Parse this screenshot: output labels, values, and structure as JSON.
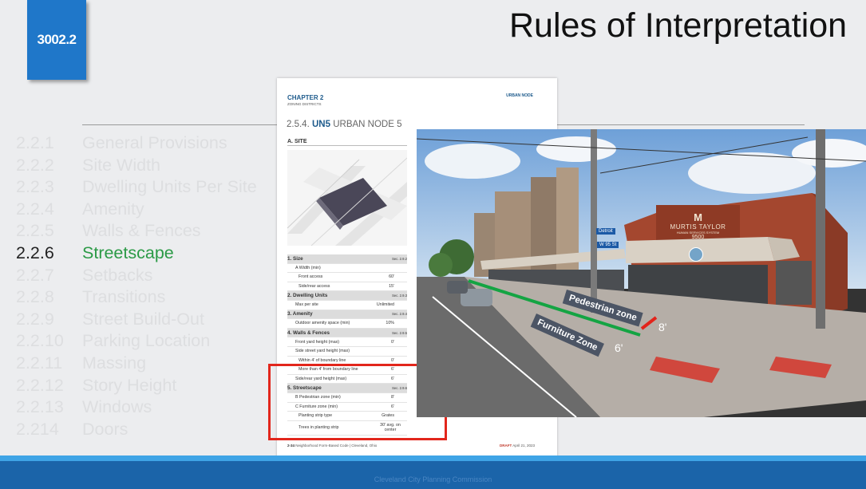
{
  "badge": "3002.2",
  "title": "Rules of Interpretation",
  "toc": [
    {
      "num": "2.2.1",
      "label": "General Provisions",
      "active": false
    },
    {
      "num": "2.2.2",
      "label": "Site Width",
      "active": false
    },
    {
      "num": "2.2.3",
      "label": "Dwelling Units Per Site",
      "active": false
    },
    {
      "num": "2.2.4",
      "label": "Amenity",
      "active": false
    },
    {
      "num": "2.2.5",
      "label": "Walls & Fences",
      "active": false
    },
    {
      "num": "2.2.6",
      "label": "Streetscape",
      "active": true
    },
    {
      "num": "2.2.7",
      "label": "Setbacks",
      "active": false
    },
    {
      "num": "2.2.8",
      "label": "Transitions",
      "active": false
    },
    {
      "num": "2.2.9",
      "label": "Street Build-Out",
      "active": false
    },
    {
      "num": "2.2.10",
      "label": "Parking Location",
      "active": false
    },
    {
      "num": "2.2.11",
      "label": "Massing",
      "active": false
    },
    {
      "num": "2.2.12",
      "label": "Story Height",
      "active": false
    },
    {
      "num": "2.2.13",
      "label": "Windows",
      "active": false
    },
    {
      "num": "2.214",
      "label": "Doors",
      "active": false
    }
  ],
  "document": {
    "chapter": "CHAPTER 2",
    "chapter_sub": "ZONING DISTRICTS",
    "urban_node": "URBAN NODE",
    "section_num": "2.5.4.",
    "section_code": "UN5",
    "section_name": "URBAN NODE 5",
    "site_label": "A. SITE",
    "table": [
      {
        "type": "h",
        "k": "1. Size",
        "v": "Sec. 2.9.2"
      },
      {
        "type": "ind1",
        "k": "A Width (min)",
        "v": ""
      },
      {
        "type": "ind2",
        "k": "Front access",
        "v": "60'"
      },
      {
        "type": "ind2",
        "k": "Side/rear access",
        "v": "15'"
      },
      {
        "type": "h",
        "k": "2. Dwelling Units",
        "v": "Sec. 2.9.3"
      },
      {
        "type": "ind1",
        "k": "Max per site",
        "v": "Unlimited"
      },
      {
        "type": "h",
        "k": "3. Amenity",
        "v": "Sec. 2.9.4"
      },
      {
        "type": "ind1",
        "k": "Outdoor amenity space (min)",
        "v": "10%"
      },
      {
        "type": "h",
        "k": "4. Walls & Fences",
        "v": "Sec. 2.9.5"
      },
      {
        "type": "ind1",
        "k": "Front yard height (max)",
        "v": "0'"
      },
      {
        "type": "ind1",
        "k": "Side street yard height (max)",
        "v": ""
      },
      {
        "type": "ind2",
        "k": "Within 4' of boundary line",
        "v": "0'"
      },
      {
        "type": "ind2",
        "k": "More than 4' from boundary line",
        "v": "6'"
      },
      {
        "type": "ind1",
        "k": "Side/rear yard height (max)",
        "v": "6'"
      },
      {
        "type": "h",
        "k": "5. Streetscape",
        "v": "Sec. 2.9.6"
      },
      {
        "type": "ind1",
        "k": "B Pedestrian zone (min)",
        "v": "8'"
      },
      {
        "type": "ind1",
        "k": "C Furniture zone (min)",
        "v": "6'"
      },
      {
        "type": "ind2",
        "k": "Planting strip type",
        "v": "Grates"
      },
      {
        "type": "ind2 tall",
        "k": "Trees in planting strip",
        "v": "30' avg. on center"
      }
    ],
    "footer": "2-34",
    "footer_text": "Neighborhood Form-Based Code | Cleveland, Ohio",
    "draft": "DRAFT",
    "draft_date": "April 21, 2023"
  },
  "photo": {
    "pedestrian_label": "Pedestrian zone",
    "furniture_label": "Furniture Zone",
    "ped_width": "8'",
    "furn_width": "6'",
    "sign_main": "MURTIS TAYLOR",
    "sign_sub": "HUMAN SERVICES SYSTEM",
    "sign_num": "9500",
    "street_sign_1": "Detroit",
    "street_sign_2": "W 95 St"
  },
  "footer": "Cleveland City Planning Commission",
  "colors": {
    "accent": "#1f77c9",
    "active": "#2b9a46",
    "highlight": "#e2261c"
  }
}
